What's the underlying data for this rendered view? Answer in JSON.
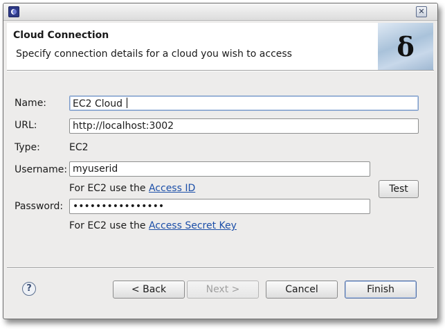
{
  "window": {
    "close_glyph": "✕"
  },
  "header": {
    "title": "Cloud Connection",
    "description": "Specify connection details for a cloud you wish to access",
    "banner_glyph": "δ"
  },
  "form": {
    "name_label": "Name:",
    "name_value": "EC2 Cloud",
    "url_label": "URL:",
    "url_value": "http://localhost:3002",
    "type_label": "Type:",
    "type_value": "EC2",
    "username_label": "Username:",
    "username_value": "myuserid",
    "username_hint_prefix": "For EC2 use the",
    "username_hint_link": "Access ID",
    "password_label": "Password:",
    "password_value": "••••••••••••••••",
    "password_hint_prefix": "For EC2 use the",
    "password_hint_link": "Access Secret Key",
    "test_label": "Test"
  },
  "footer": {
    "help_glyph": "?",
    "back_label": "< Back",
    "next_label": "Next >",
    "cancel_label": "Cancel",
    "finish_label": "Finish"
  },
  "colors": {
    "link": "#1c4fa8",
    "dialog_bg": "#edeceb",
    "focus_border": "#7b9bc9"
  }
}
